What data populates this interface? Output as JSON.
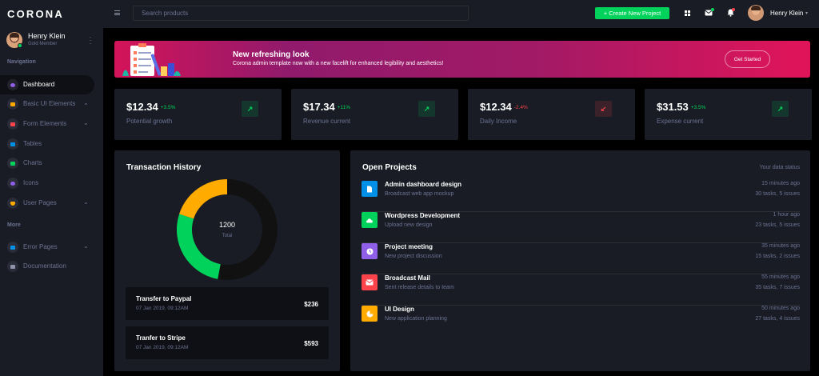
{
  "brand": "CORONA",
  "profile": {
    "name": "Henry Klein",
    "role": "Gold Member"
  },
  "sidebar": {
    "nav_heading": "Navigation",
    "items": [
      {
        "label": "Dashboard",
        "icon": "speedometer-icon",
        "color": "#8f5fe8"
      },
      {
        "label": "Basic UI Elements",
        "icon": "laptop-icon",
        "color": "#ffab00"
      },
      {
        "label": "Form Elements",
        "icon": "playlist-icon",
        "color": "#fc424a"
      },
      {
        "label": "Tables",
        "icon": "table-icon",
        "color": "#0090e7"
      },
      {
        "label": "Charts",
        "icon": "chart-line-icon",
        "color": "#00d25b"
      },
      {
        "label": "Icons",
        "icon": "contacts-icon",
        "color": "#8f5fe8"
      },
      {
        "label": "User Pages",
        "icon": "security-icon",
        "color": "#ffab00"
      }
    ],
    "more_heading": "More",
    "more_items": [
      {
        "label": "Error Pages",
        "icon": "lock-icon",
        "color": "#0090e7"
      },
      {
        "label": "Documentation",
        "icon": "file-document-icon",
        "color": "#8f94a8"
      }
    ]
  },
  "topbar": {
    "search_placeholder": "Search products",
    "create_button": "+ Create New Project",
    "user_name": "Henry Klein"
  },
  "banner": {
    "title": "New refreshing look",
    "text": "Corona admin template now with a new facelift for enhanced legibility and aesthetics!",
    "button": "Get Started"
  },
  "stats": [
    {
      "value": "$12.34",
      "change": "+3.5%",
      "label": "Potential growth",
      "trend": "up"
    },
    {
      "value": "$17.34",
      "change": "+11%",
      "label": "Revenue current",
      "trend": "up"
    },
    {
      "value": "$12.34",
      "change": "-2.4%",
      "label": "Daily Income",
      "trend": "down"
    },
    {
      "value": "$31.53",
      "change": "+3.5%",
      "label": "Expense current",
      "trend": "up"
    }
  ],
  "transaction_history": {
    "title": "Transaction History",
    "total_value": "1200",
    "total_label": "Total",
    "chart_segments": [
      {
        "fraction": 0.53,
        "color": "#111111"
      },
      {
        "fraction": 0.27,
        "color": "#00d25b"
      },
      {
        "fraction": 0.2,
        "color": "#ffab00"
      }
    ],
    "transactions": [
      {
        "title": "Transfer to Paypal",
        "date": "07 Jan 2019, 09:12AM",
        "amount": "$236"
      },
      {
        "title": "Tranfer to Stripe",
        "date": "07 Jan 2019, 09:12AM",
        "amount": "$593"
      }
    ]
  },
  "open_projects": {
    "title": "Open Projects",
    "status_label": "Your data status",
    "projects": [
      {
        "title": "Admin dashboard design",
        "subtitle": "Broadcast web app mockup",
        "time": "15 minutes ago",
        "tasks": "30 tasks, 5 issues",
        "icon": "file-icon",
        "color": "#0090e7"
      },
      {
        "title": "Wordpress Development",
        "subtitle": "Upload new design",
        "time": "1 hour ago",
        "tasks": "23 tasks, 5 issues",
        "icon": "cloud-upload-icon",
        "color": "#00d25b"
      },
      {
        "title": "Project meeting",
        "subtitle": "New project discussion",
        "time": "35 minutes ago",
        "tasks": "15 tasks, 2 issues",
        "icon": "clock-icon",
        "color": "#8f5fe8"
      },
      {
        "title": "Broadcast Mail",
        "subtitle": "Sent release details to team",
        "time": "55 minutes ago",
        "tasks": "35 tasks, 7 issues",
        "icon": "mail-icon",
        "color": "#fc424a"
      },
      {
        "title": "UI Design",
        "subtitle": "New application planning",
        "time": "50 minutes ago",
        "tasks": "27 tasks, 4 issues",
        "icon": "chart-pie-icon",
        "color": "#ffab00"
      }
    ]
  },
  "colors": {
    "success": "#00d25b",
    "danger": "#fc424a",
    "card_bg": "#191c24",
    "muted": "#6c7293"
  }
}
